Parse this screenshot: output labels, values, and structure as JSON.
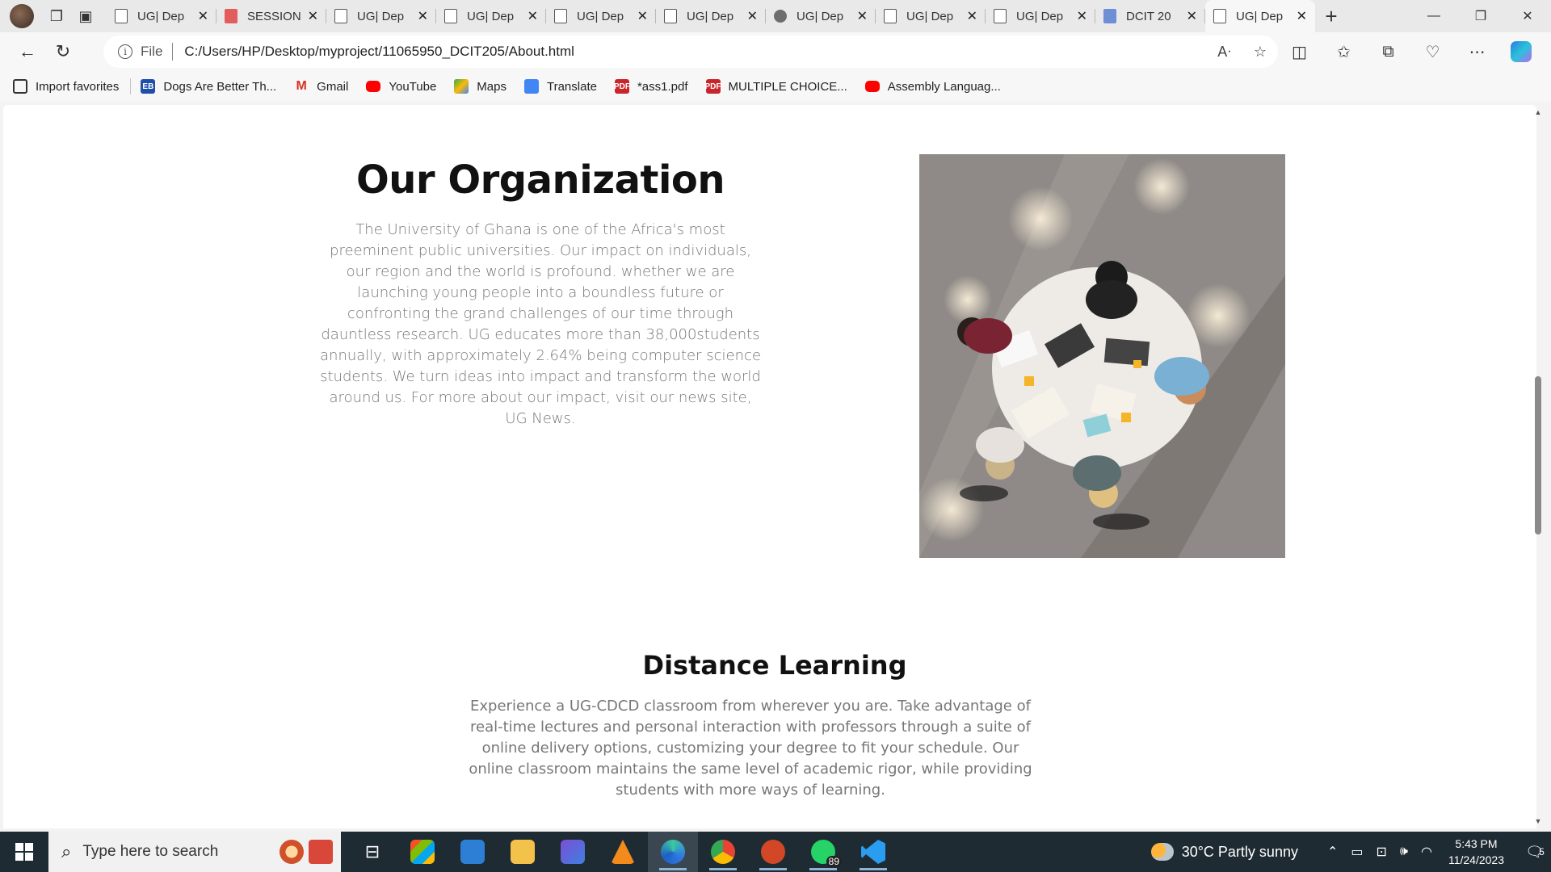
{
  "browser": {
    "tabs": [
      {
        "label": "UG| Dep",
        "icon": "doc"
      },
      {
        "label": "SESSION",
        "icon": "pdf"
      },
      {
        "label": "UG| Dep",
        "icon": "doc"
      },
      {
        "label": "UG| Dep",
        "icon": "doc"
      },
      {
        "label": "UG| Dep",
        "icon": "doc"
      },
      {
        "label": "UG| Dep",
        "icon": "doc"
      },
      {
        "label": "UG| Dep",
        "icon": "ext"
      },
      {
        "label": "UG| Dep",
        "icon": "doc"
      },
      {
        "label": "UG| Dep",
        "icon": "doc"
      },
      {
        "label": "DCIT 20",
        "icon": "gdoc"
      },
      {
        "label": "UG| Dep",
        "icon": "doc",
        "active": true
      }
    ],
    "address": {
      "scheme": "File",
      "url": "C:/Users/HP/Desktop/myproject/11065950_DCIT205/About.html"
    },
    "favorites": [
      {
        "label": "Import favorites",
        "icon": "import"
      },
      {
        "label": "Dogs Are Better Th...",
        "icon": "eb",
        "glyph": "EB"
      },
      {
        "label": "Gmail",
        "icon": "gmail",
        "glyph": "M"
      },
      {
        "label": "YouTube",
        "icon": "youtube"
      },
      {
        "label": "Maps",
        "icon": "maps"
      },
      {
        "label": "Translate",
        "icon": "translate"
      },
      {
        "label": "*ass1.pdf",
        "icon": "pdf",
        "glyph": "PDF"
      },
      {
        "label": "MULTIPLE CHOICE...",
        "icon": "pdf",
        "glyph": "PDF"
      },
      {
        "label": "Assembly Languag...",
        "icon": "youtube"
      }
    ]
  },
  "page": {
    "organization": {
      "title": "Our Organization",
      "body": "The University of Ghana is one of the Africa's most preeminent public universities. Our impact on individuals, our region and the world is profound. whether we are launching young people into a boundless future or confronting the grand challenges of our time through dauntless research. UG educates more than 38,000students annually, with approximately 2.64% being computer science students. We turn ideas into impact and transform the world around us. For more about our impact, visit our news site, UG News."
    },
    "distance_learning": {
      "title": "Distance Learning",
      "body": "Experience a UG-CDCD classroom from wherever you are. Take advantage of real-time lectures and personal interaction with professors through a suite of online delivery options, customizing your degree to fit your schedule. Our online classroom maintains the same level of academic rigor, while providing students with more ways of learning."
    }
  },
  "taskbar": {
    "search_placeholder": "Type here to search",
    "weather": "30°C  Partly sunny",
    "time": "5:43 PM",
    "date": "11/24/2023",
    "whatsapp_badge": "89",
    "notification_count": "5"
  }
}
